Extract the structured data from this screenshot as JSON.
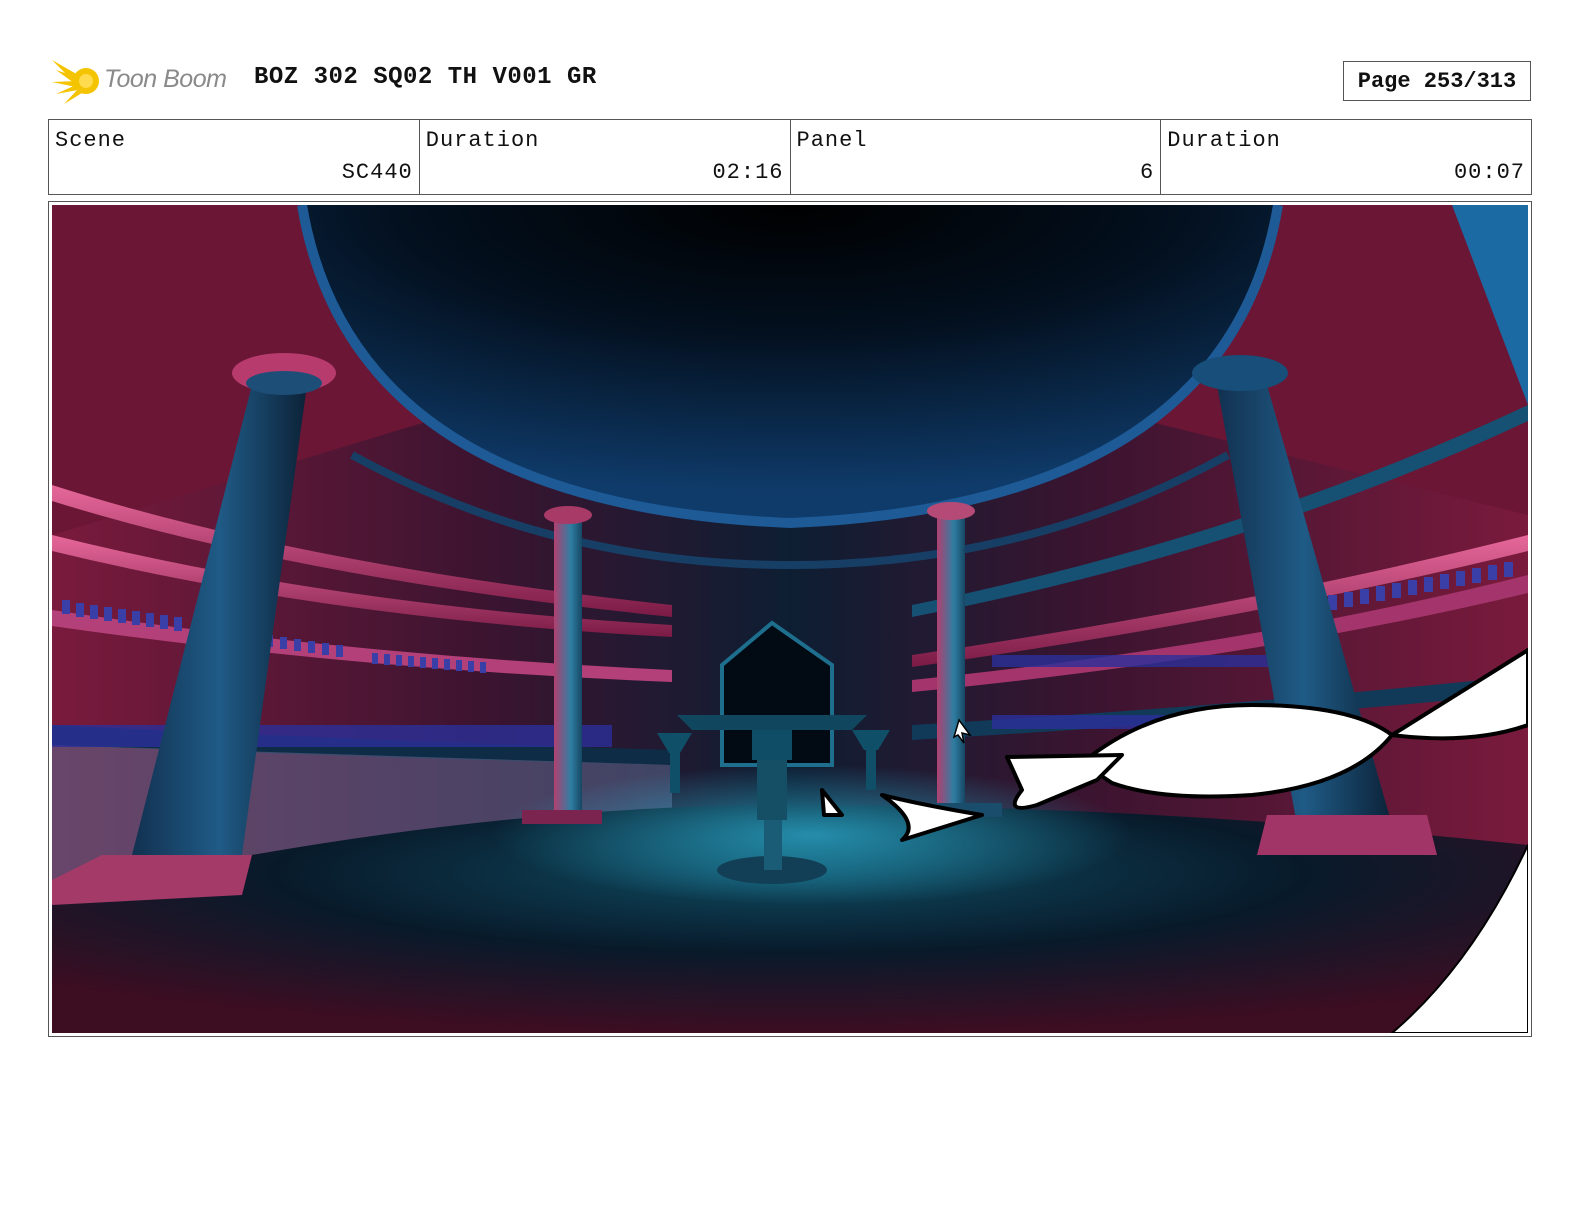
{
  "header": {
    "logo_text": "Toon Boom",
    "logo_icon": "toon-boom-star-icon",
    "title": "BOZ 302 SQ02 TH V001 GR",
    "page_label": "Page 253/313"
  },
  "info": {
    "scene_label": "Scene",
    "scene_value": "SC440",
    "scene_duration_label": "Duration",
    "scene_duration_value": "02:16",
    "panel_label": "Panel",
    "panel_value": "6",
    "panel_duration_label": "Duration",
    "panel_duration_value": "00:07"
  },
  "colors": {
    "accent_yellow": "#f5c400",
    "magenta": "#c2306e",
    "teal": "#1b6f8c"
  }
}
